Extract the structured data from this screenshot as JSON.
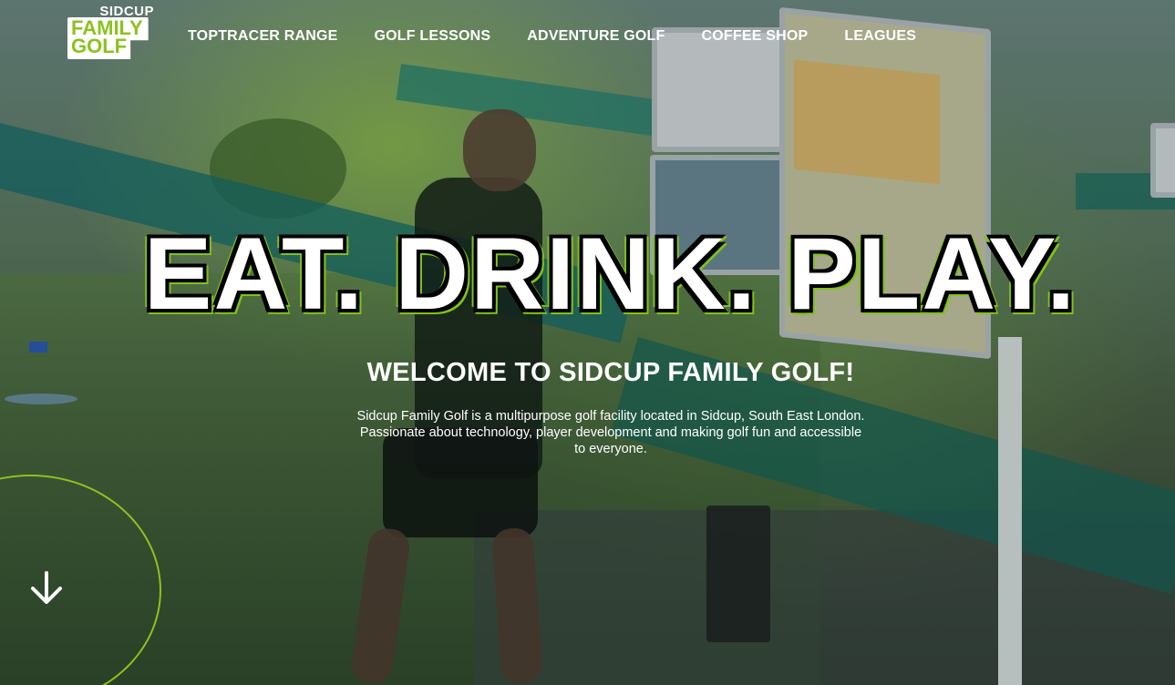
{
  "logo": {
    "top": "SIDCUP",
    "line1": "FAMILY",
    "line2": "GOLF"
  },
  "nav": {
    "items": [
      {
        "label": "TOPTRACER RANGE"
      },
      {
        "label": "GOLF LESSONS"
      },
      {
        "label": "ADVENTURE GOLF"
      },
      {
        "label": "COFFEE SHOP"
      },
      {
        "label": "LEAGUES"
      }
    ]
  },
  "hero": {
    "headline": "EAT. DRINK. PLAY.",
    "welcome": "WELCOME TO SIDCUP FAMILY GOLF!",
    "intro": "Sidcup Family Golf is a multipurpose golf facility located in Sidcup, South East London. Passionate about technology, player development and making golf fun and accessible to everyone."
  },
  "scroll": {
    "icon": "arrow-down-icon"
  },
  "colors": {
    "accent": "#8cc21f",
    "text": "#ffffff"
  }
}
